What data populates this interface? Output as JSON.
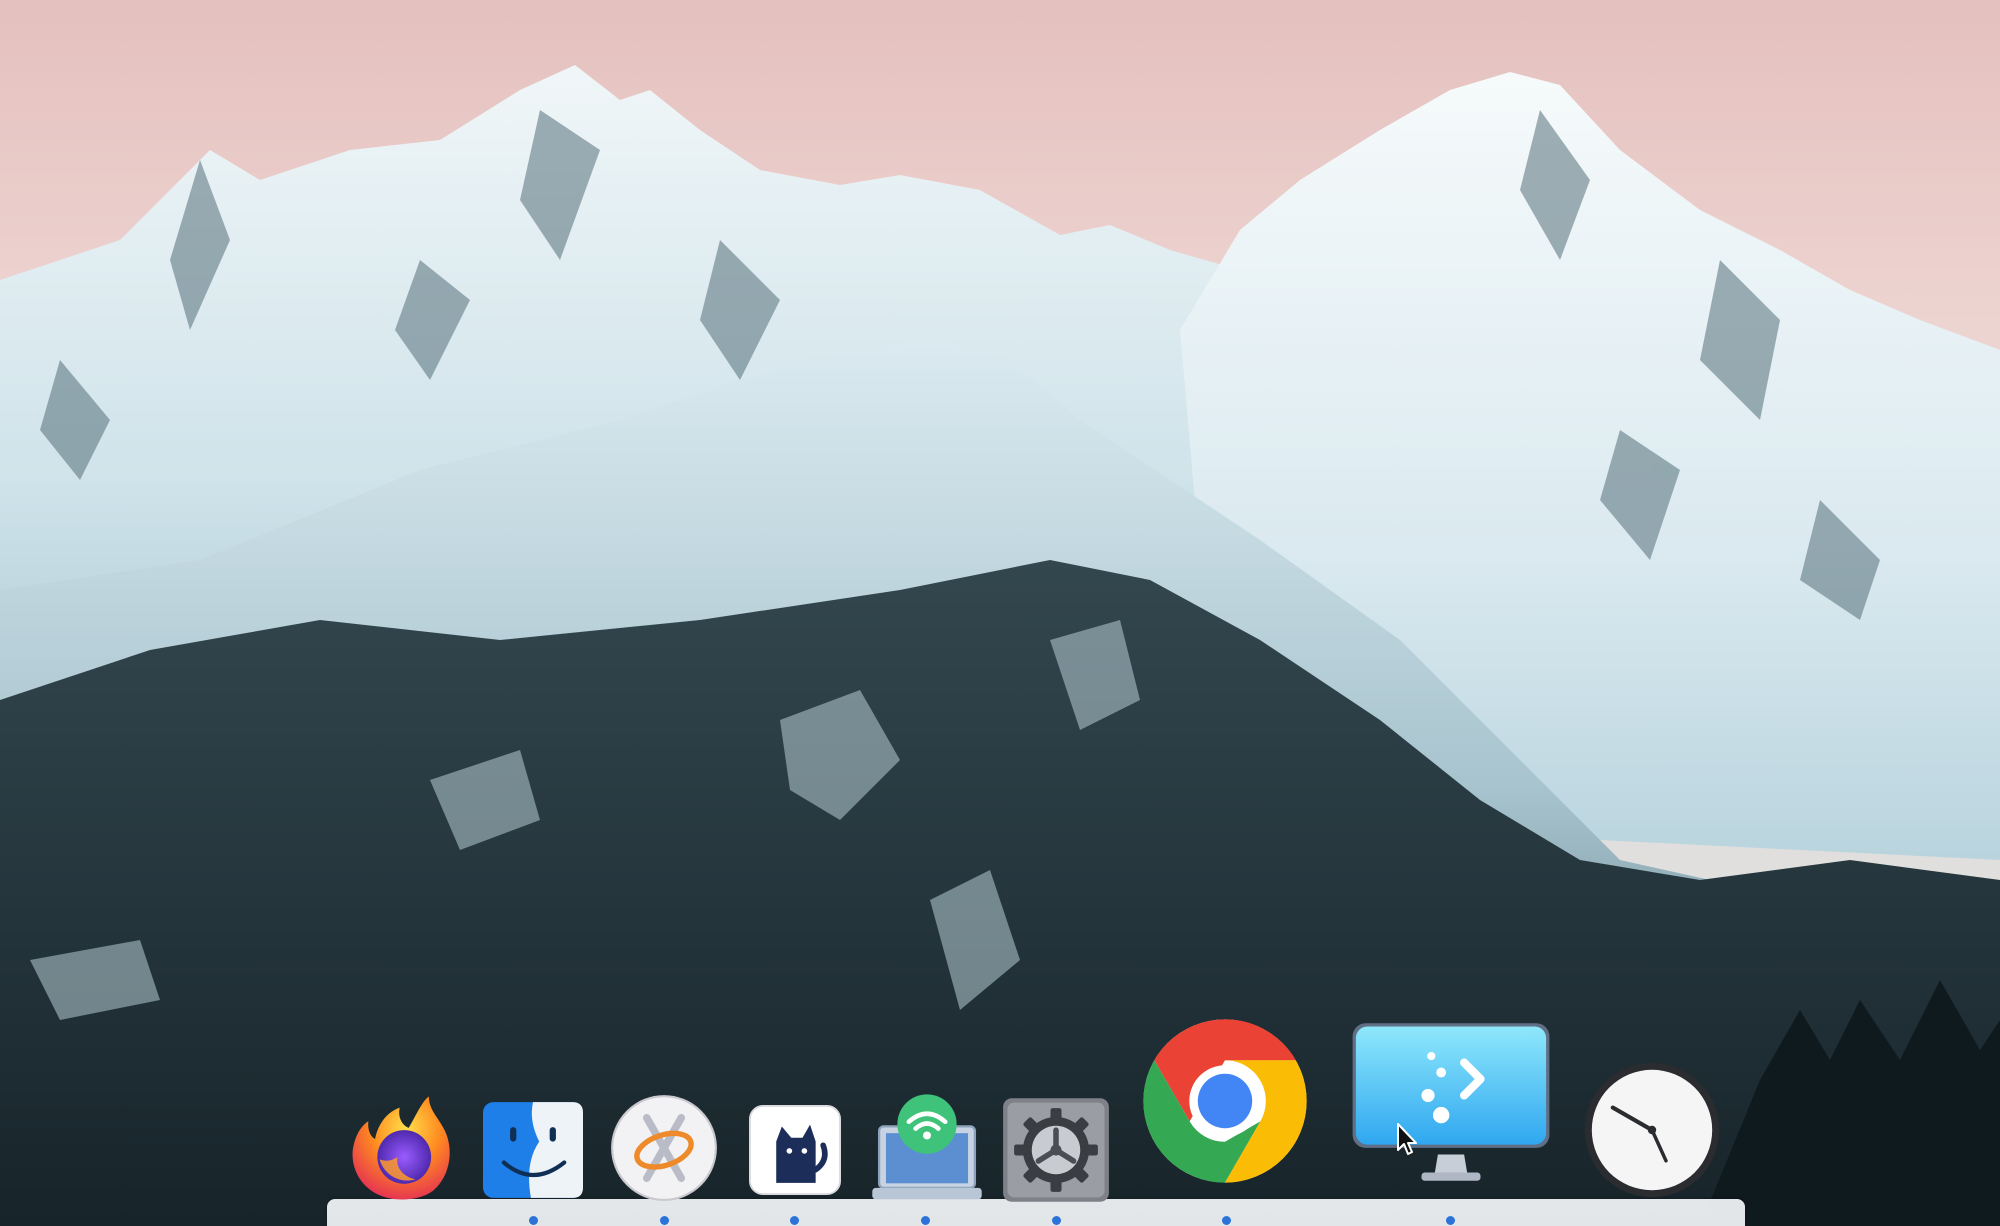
{
  "desktop": {
    "wallpaper": "snowy-mountains-wallpaper",
    "sky_top_color": "#e9c7c4",
    "snow_color": "#e8f2f6",
    "forest_color": "#1f2f36"
  },
  "dock": {
    "items": [
      {
        "id": "firefox",
        "icon": "firefox-icon",
        "running": false
      },
      {
        "id": "finder",
        "icon": "finder-icon",
        "running": true
      },
      {
        "id": "xquartz",
        "icon": "xquartz-icon",
        "running": true
      },
      {
        "id": "cat-app",
        "icon": "cat-icon",
        "running": true
      },
      {
        "id": "network",
        "icon": "wifi-laptop-icon",
        "running": true
      },
      {
        "id": "system-preferences",
        "icon": "gear-icon",
        "running": true
      },
      {
        "id": "chrome",
        "icon": "chrome-icon",
        "running": true
      },
      {
        "id": "screen-sharing",
        "icon": "monitor-icon",
        "running": true
      },
      {
        "id": "clock",
        "icon": "clock-icon",
        "running": false
      }
    ],
    "running_indicator_color": "#2b73d9"
  },
  "cursor": {
    "icon": "pointer-cursor-icon"
  }
}
